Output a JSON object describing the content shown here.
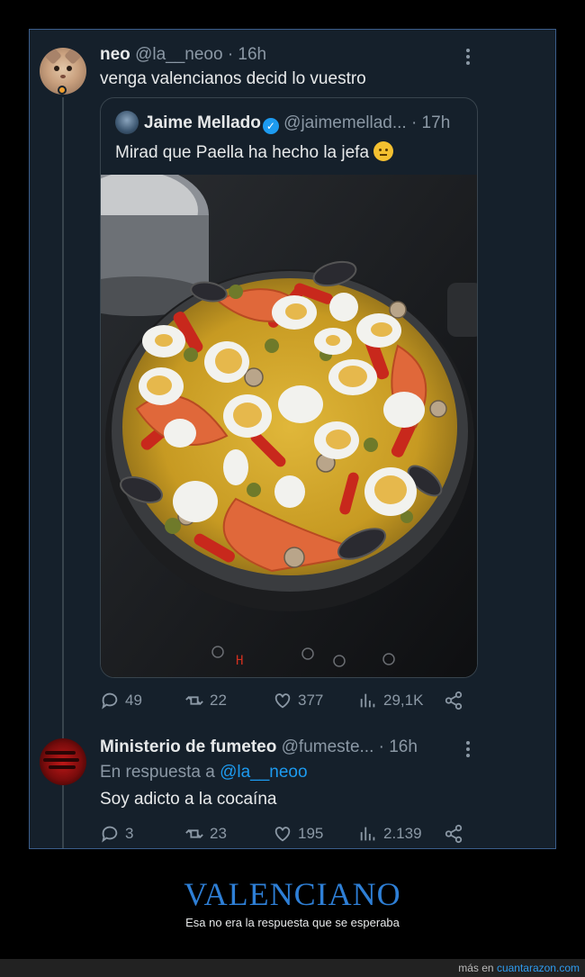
{
  "tweet": {
    "display_name": "neo",
    "meta": "@la__neoo · 16h",
    "text": "venga valencianos decid lo vuestro"
  },
  "quote": {
    "display_name": "Jaime Mellado",
    "meta": "@jaimemellad... · 17h",
    "text": "Mirad que Paella ha hecho la jefa",
    "emoji": "neutral-face-emoji",
    "photo": "paella-photo"
  },
  "tweet_actions": {
    "replies": "49",
    "retweets": "22",
    "likes": "377",
    "views": "29,1K"
  },
  "reply": {
    "display_name": "Ministerio de fumeteo",
    "meta": "@fumeste... · 16h",
    "reply_prefix": "En respuesta a",
    "reply_handle": "@la__neoo",
    "text": "Soy adicto a la cocaína"
  },
  "reply_actions": {
    "replies": "3",
    "retweets": "23",
    "likes": "195",
    "views": "2.139"
  },
  "caption": {
    "title": "VALENCIANO",
    "subtitle": "Esa no era la respuesta que se esperaba"
  },
  "footer": {
    "prefix": "más en",
    "site": "cuantarazon.com"
  },
  "colors": {
    "background": "#15202b",
    "accent": "#1d9bf0",
    "caption_title": "#2e7fd6"
  }
}
